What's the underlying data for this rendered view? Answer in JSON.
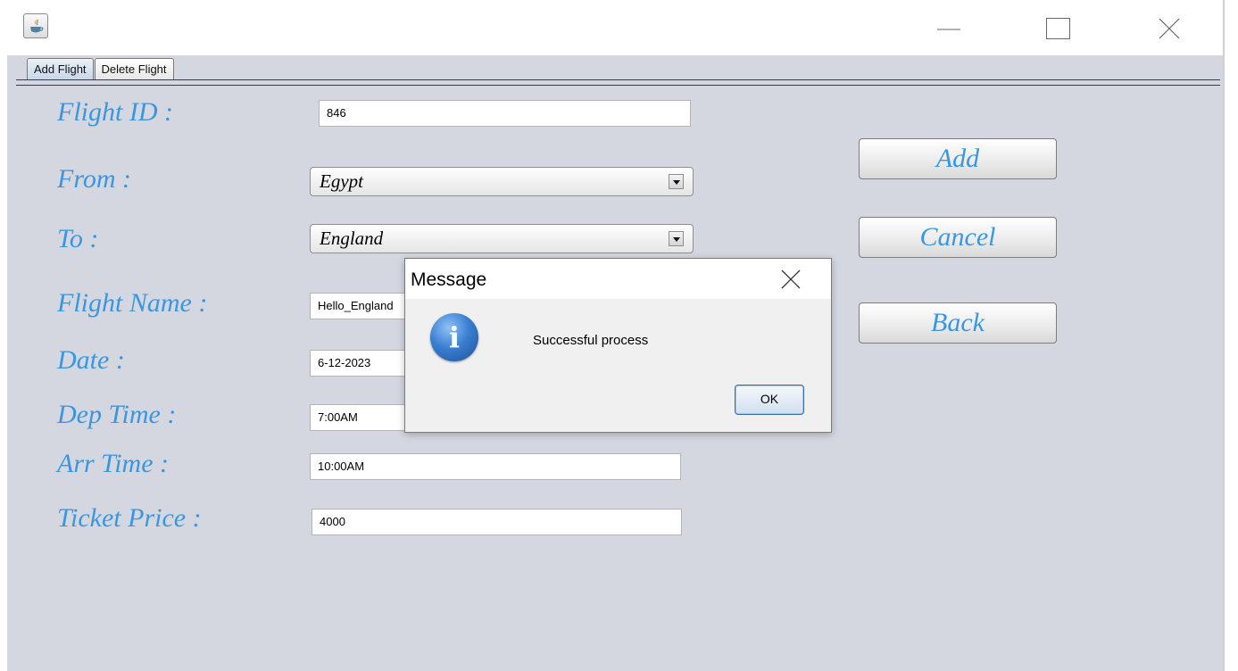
{
  "window": {
    "icon": "java-app-icon",
    "controls": {
      "minimize": "minimize-icon",
      "maximize": "maximize-icon",
      "close": "close-icon"
    }
  },
  "tabs": [
    {
      "label": "Add Flight",
      "active": true
    },
    {
      "label": "Delete Flight",
      "active": false
    }
  ],
  "form": {
    "flight_id": {
      "label": "Flight ID :",
      "value": "846"
    },
    "from": {
      "label": "From :",
      "value": "Egypt"
    },
    "to": {
      "label": "To :",
      "value": "England"
    },
    "flight_name": {
      "label": "Flight Name :",
      "value": "Hello_England"
    },
    "date": {
      "label": "Date :",
      "value": "6-12-2023"
    },
    "dep_time": {
      "label": "Dep Time :",
      "value": "7:00AM"
    },
    "arr_time": {
      "label": "Arr Time :",
      "value": "10:00AM"
    },
    "ticket_price": {
      "label": "Ticket Price :",
      "value": "4000"
    }
  },
  "actions": {
    "add": "Add",
    "cancel": "Cancel",
    "back": "Back"
  },
  "dialog": {
    "title": "Message",
    "icon": "info-icon",
    "icon_glyph": "i",
    "message": "Successful process",
    "ok": "OK"
  },
  "colors": {
    "label": "#3b96e0",
    "panel_background": "#d4d7e0",
    "tab_rule": "#333c52"
  }
}
